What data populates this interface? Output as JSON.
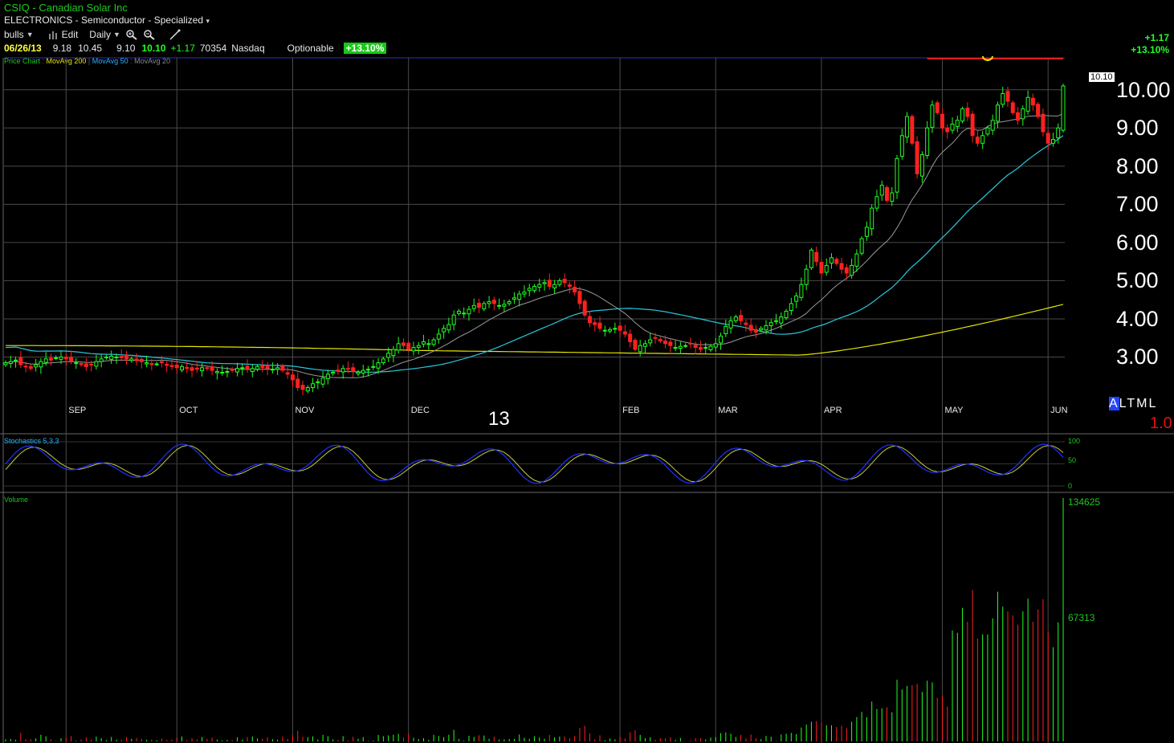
{
  "header": {
    "title": "CSIQ - Canadian Solar Inc",
    "sector": "ELECTRONICS - Semiconductor - Specialized",
    "sector_caret": "▾"
  },
  "toolbar": {
    "watchlist": "bulls",
    "edit": "Edit",
    "period": "Daily"
  },
  "quote": {
    "date": "06/26/13",
    "open": "9.18",
    "high": "10.45",
    "low": "9.10",
    "last": "10.10",
    "change": "+1.17",
    "volume": "70354",
    "exchange": "Nasdaq",
    "optionable": "Optionable",
    "pct": "+13.10%"
  },
  "right_header": {
    "change": "+1.17",
    "pct": "+13.10%"
  },
  "legend": {
    "price_chart": "Price Chart",
    "ma200": "MovAvg 200",
    "ma50": "MovAvg 50",
    "ma20": "MovAvg 20"
  },
  "price_tag": "10.10",
  "altml": {
    "a": "A",
    "rest": "LTML",
    "value": "1.0"
  },
  "big_label": "13",
  "stoch_label": "Stochastics 5,3,3",
  "volume_label": "Volume",
  "chart_data": {
    "type": "candlestick",
    "price_axis": {
      "ticks": [
        "3.00",
        "4.00",
        "5.00",
        "6.00",
        "7.00",
        "8.00",
        "9.00",
        "10.00"
      ],
      "ylim": [
        2.0,
        10.5
      ]
    },
    "months": [
      "SEP",
      "OCT",
      "NOV",
      "DEC",
      "FEB",
      "MAR",
      "APR",
      "MAY",
      "JUN"
    ],
    "stoch_axis": [
      "100",
      "50",
      "0"
    ],
    "volume_axis": [
      "134625",
      "67313"
    ],
    "month_index": {
      "SEP": 12,
      "OCT": 34,
      "NOV": 57,
      "DEC": 80,
      "FEB": 122,
      "MAR": 141,
      "APR": 162,
      "MAY": 186,
      "JUN": 207
    },
    "close": [
      2.85,
      2.88,
      2.92,
      2.8,
      2.75,
      2.7,
      2.8,
      2.88,
      2.95,
      2.92,
      2.98,
      3.0,
      2.95,
      2.9,
      2.85,
      2.8,
      2.75,
      2.8,
      2.88,
      2.95,
      3.0,
      3.02,
      3.0,
      2.98,
      2.95,
      2.95,
      2.9,
      2.88,
      2.85,
      2.8,
      2.82,
      2.85,
      2.78,
      2.75,
      2.72,
      2.75,
      2.7,
      2.65,
      2.68,
      2.72,
      2.7,
      2.65,
      2.62,
      2.6,
      2.62,
      2.65,
      2.7,
      2.72,
      2.68,
      2.7,
      2.75,
      2.72,
      2.7,
      2.68,
      2.72,
      2.65,
      2.55,
      2.4,
      2.2,
      2.15,
      2.2,
      2.3,
      2.35,
      2.45,
      2.55,
      2.6,
      2.65,
      2.7,
      2.68,
      2.62,
      2.6,
      2.65,
      2.68,
      2.75,
      2.85,
      2.95,
      3.1,
      3.2,
      3.35,
      3.3,
      3.2,
      3.25,
      3.3,
      3.4,
      3.35,
      3.45,
      3.6,
      3.75,
      3.85,
      4.1,
      4.2,
      4.15,
      4.25,
      4.35,
      4.3,
      4.4,
      4.45,
      4.4,
      4.35,
      4.38,
      4.45,
      4.55,
      4.65,
      4.7,
      4.8,
      4.85,
      4.9,
      4.95,
      4.85,
      4.9,
      5.0,
      4.95,
      4.85,
      4.7,
      4.4,
      4.1,
      3.9,
      3.85,
      3.75,
      3.7,
      3.72,
      3.75,
      3.7,
      3.6,
      3.4,
      3.2,
      3.3,
      3.35,
      3.45,
      3.5,
      3.42,
      3.35,
      3.3,
      3.25,
      3.28,
      3.3,
      3.35,
      3.25,
      3.2,
      3.25,
      3.28,
      3.35,
      3.55,
      3.8,
      3.95,
      4.05,
      3.95,
      3.85,
      3.7,
      3.65,
      3.75,
      3.82,
      3.9,
      3.95,
      4.05,
      4.2,
      4.4,
      4.6,
      4.9,
      5.3,
      5.8,
      5.5,
      5.2,
      5.4,
      5.6,
      5.45,
      5.3,
      5.2,
      5.4,
      5.7,
      6.1,
      6.4,
      6.9,
      7.2,
      7.5,
      7.1,
      7.3,
      8.2,
      8.8,
      9.3,
      8.6,
      7.8,
      8.3,
      9.0,
      9.6,
      9.4,
      9.0,
      8.9,
      9.1,
      9.2,
      9.5,
      9.3,
      8.8,
      8.6,
      8.8,
      9.0,
      9.2,
      9.6,
      9.9,
      9.7,
      9.4,
      9.2,
      9.5,
      9.8,
      9.6,
      9.3,
      8.9,
      8.6,
      8.7,
      9.0,
      10.1
    ],
    "ma200": {
      "from": 3.3,
      "mid": 3.05,
      "end": 4.38
    },
    "ma50": {
      "start": 3.15,
      "end": 7.4
    },
    "ma20_end": 9.2
  },
  "colors": {
    "up": "#22ff22",
    "down": "#ff2020",
    "grid": "#4a4a4a",
    "ma200": "#e6e600",
    "ma50": "#28c8dc",
    "ma20": "#999999",
    "stoch_k": "#2030ff",
    "stoch_d": "#c8c840",
    "price_axis": "#ffffff",
    "month_label": "#e8e8e8",
    "axis_small": "#1ec81e"
  }
}
